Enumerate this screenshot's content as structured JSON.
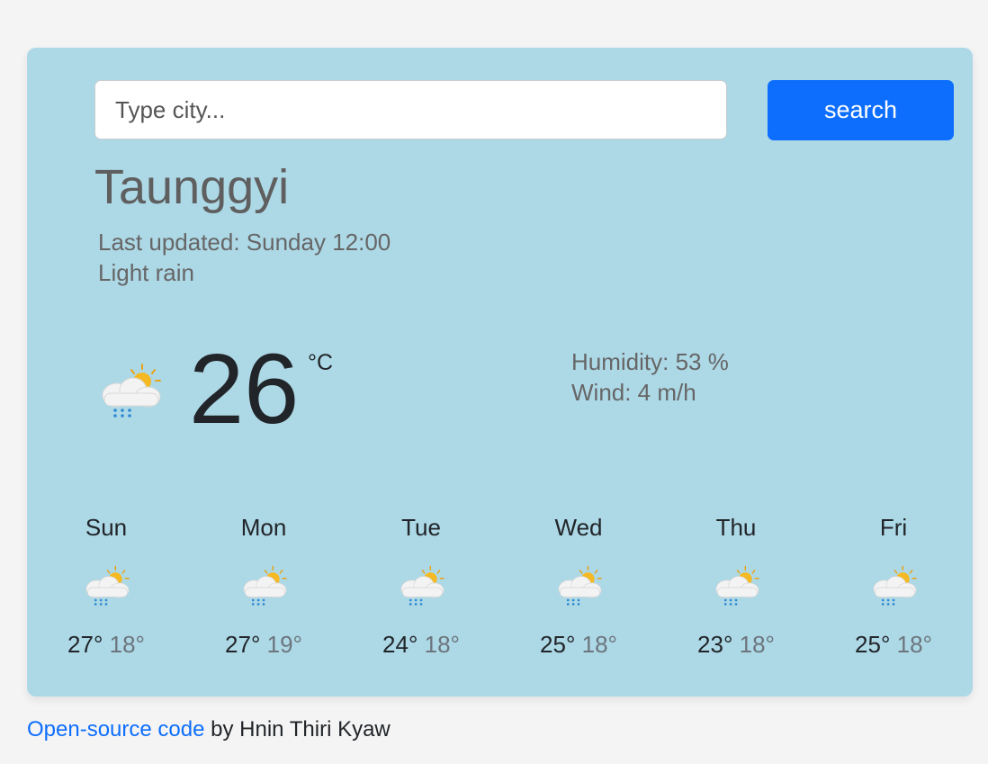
{
  "search": {
    "placeholder": "Type city...",
    "value": "",
    "button_label": "search"
  },
  "current": {
    "city": "Taunggyi",
    "last_updated": "Last updated: Sunday 12:00",
    "description": "Light rain",
    "icon": "light-rain-sun-icon",
    "temperature": "26",
    "unit": "°C",
    "humidity": "Humidity: 53 %",
    "wind": "Wind: 4 m/h"
  },
  "forecast": [
    {
      "day": "Sun",
      "max": "27°",
      "min": "18°",
      "icon": "light-rain-sun-icon"
    },
    {
      "day": "Mon",
      "max": "27°",
      "min": "19°",
      "icon": "light-rain-sun-icon"
    },
    {
      "day": "Tue",
      "max": "24°",
      "min": "18°",
      "icon": "light-rain-sun-icon"
    },
    {
      "day": "Wed",
      "max": "25°",
      "min": "18°",
      "icon": "light-rain-sun-icon"
    },
    {
      "day": "Thu",
      "max": "23°",
      "min": "18°",
      "icon": "light-rain-sun-icon"
    },
    {
      "day": "Fri",
      "max": "25°",
      "min": "18°",
      "icon": "light-rain-sun-icon"
    }
  ],
  "footer": {
    "link_text": "Open-source code",
    "suffix": " by Hnin Thiri Kyaw"
  },
  "colors": {
    "card_background": "#add8e6",
    "page_background": "#f4f4f4",
    "accent": "#0d6efd"
  }
}
